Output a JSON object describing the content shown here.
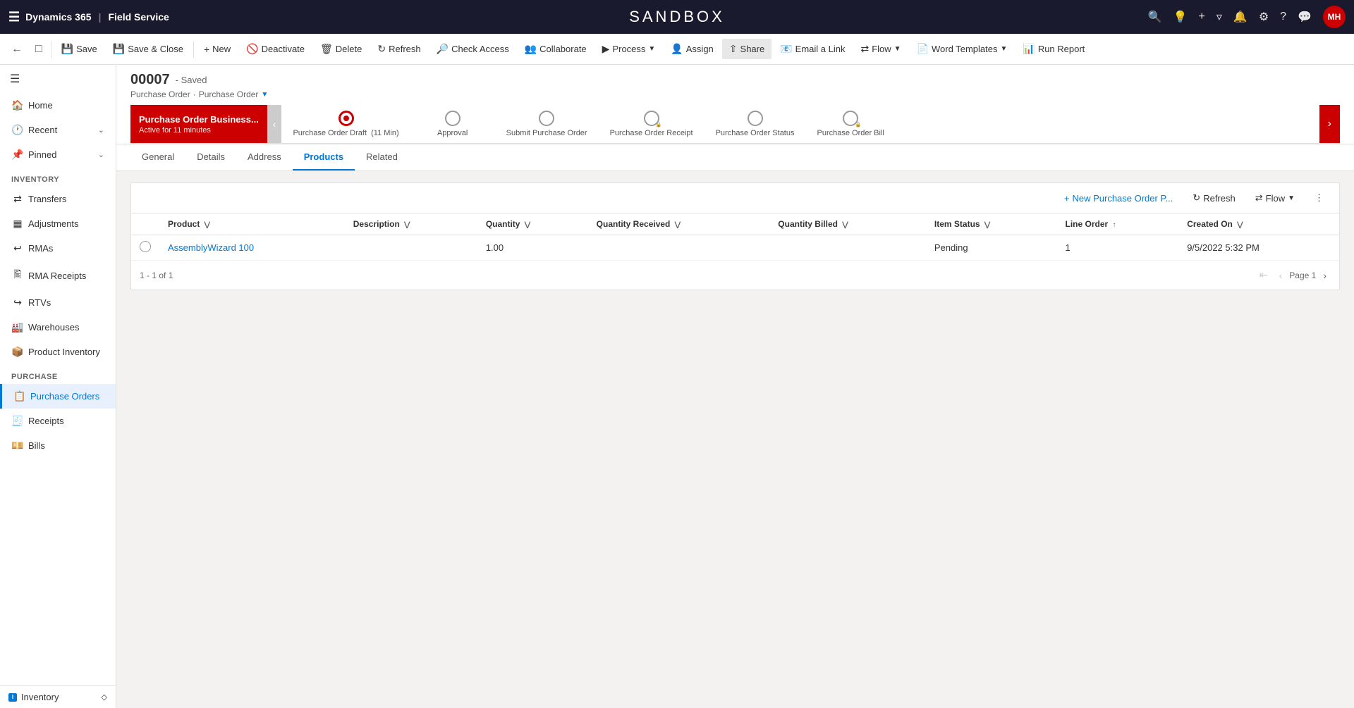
{
  "topNav": {
    "appName": "Dynamics 365",
    "module": "Field Service",
    "sandboxTitle": "SANDBOX",
    "avatar": "MH",
    "avatarBg": "#c00"
  },
  "commandBar": {
    "save": "Save",
    "saveClose": "Save & Close",
    "new": "New",
    "deactivate": "Deactivate",
    "delete": "Delete",
    "refresh": "Refresh",
    "checkAccess": "Check Access",
    "collaborate": "Collaborate",
    "process": "Process",
    "assign": "Assign",
    "share": "Share",
    "emailLink": "Email a Link",
    "flow": "Flow",
    "wordTemplates": "Word Templates",
    "runReport": "Run Report"
  },
  "record": {
    "id": "00007",
    "status": "Saved",
    "breadcrumb1": "Purchase Order",
    "breadcrumb2": "Purchase Order",
    "breadcrumbSep": "·"
  },
  "processFlow": {
    "activeStage": "Purchase Order Business...",
    "activeStageSub": "Active for 11 minutes",
    "stages": [
      {
        "label": "Purchase Order Draft  (11 Min)",
        "active": true,
        "locked": false
      },
      {
        "label": "Approval",
        "active": false,
        "locked": false
      },
      {
        "label": "Submit Purchase Order",
        "active": false,
        "locked": false
      },
      {
        "label": "Purchase Order Receipt",
        "active": false,
        "locked": true
      },
      {
        "label": "Purchase Order Status",
        "active": false,
        "locked": false
      },
      {
        "label": "Purchase Order Bill",
        "active": false,
        "locked": true
      }
    ]
  },
  "tabs": [
    {
      "label": "General",
      "active": false
    },
    {
      "label": "Details",
      "active": false
    },
    {
      "label": "Address",
      "active": false
    },
    {
      "label": "Products",
      "active": true
    },
    {
      "label": "Related",
      "active": false
    }
  ],
  "subGrid": {
    "newButton": "New Purchase Order P...",
    "refreshButton": "Refresh",
    "flowButton": "Flow",
    "moreButton": "⋮",
    "columns": [
      {
        "label": "Product",
        "sortable": true
      },
      {
        "label": "Description",
        "sortable": true
      },
      {
        "label": "Quantity",
        "sortable": true
      },
      {
        "label": "Quantity Received",
        "sortable": true
      },
      {
        "label": "Quantity Billed",
        "sortable": true
      },
      {
        "label": "Item Status",
        "sortable": true
      },
      {
        "label": "Line Order",
        "sortable": true,
        "sortDir": "asc"
      },
      {
        "label": "Created On",
        "sortable": true
      }
    ],
    "rows": [
      {
        "product": "AssemblyWizard 100",
        "description": "",
        "quantity": "1.00",
        "quantityReceived": "",
        "quantityBilled": "",
        "itemStatus": "Pending",
        "lineOrder": "1",
        "createdOn": "9/5/2022 5:32 PM"
      }
    ],
    "paginationText": "1 - 1 of 1",
    "pageLabel": "Page 1"
  },
  "sidebar": {
    "sections": [
      {
        "label": "Inventory",
        "items": [
          {
            "icon": "⇄",
            "label": "Transfers",
            "active": false
          },
          {
            "icon": "⊞",
            "label": "Adjustments",
            "active": false
          },
          {
            "icon": "↩",
            "label": "RMAs",
            "active": false
          },
          {
            "icon": "📥",
            "label": "RMA Receipts",
            "active": false
          },
          {
            "icon": "↗",
            "label": "RTVs",
            "active": false
          },
          {
            "icon": "🏭",
            "label": "Warehouses",
            "active": false
          },
          {
            "icon": "📦",
            "label": "Product Inventory",
            "active": false
          }
        ]
      },
      {
        "label": "Purchase",
        "items": [
          {
            "icon": "📋",
            "label": "Purchase Orders",
            "active": true
          },
          {
            "icon": "🧾",
            "label": "Receipts",
            "active": false
          },
          {
            "icon": "💰",
            "label": "Bills",
            "active": false
          }
        ]
      }
    ],
    "topItems": [
      {
        "icon": "🏠",
        "label": "Home",
        "expand": false
      },
      {
        "icon": "🕐",
        "label": "Recent",
        "expand": true
      },
      {
        "icon": "📌",
        "label": "Pinned",
        "expand": true
      }
    ],
    "bottomLabel": "Inventory",
    "bottomIcon": "I"
  }
}
